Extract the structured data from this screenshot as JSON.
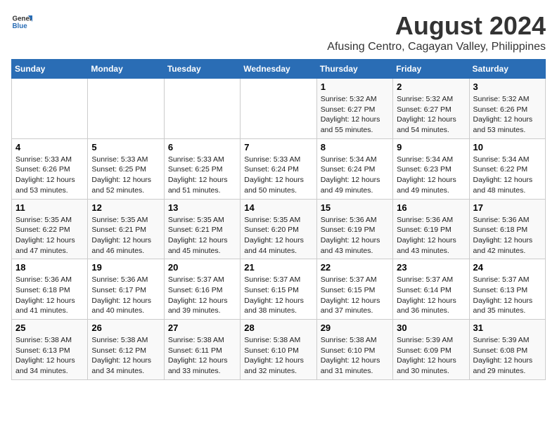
{
  "logo": {
    "general": "General",
    "blue": "Blue"
  },
  "title": "August 2024",
  "subtitle": "Afusing Centro, Cagayan Valley, Philippines",
  "days_of_week": [
    "Sunday",
    "Monday",
    "Tuesday",
    "Wednesday",
    "Thursday",
    "Friday",
    "Saturday"
  ],
  "weeks": [
    [
      {
        "day": "",
        "info": ""
      },
      {
        "day": "",
        "info": ""
      },
      {
        "day": "",
        "info": ""
      },
      {
        "day": "",
        "info": ""
      },
      {
        "day": "1",
        "info": "Sunrise: 5:32 AM\nSunset: 6:27 PM\nDaylight: 12 hours\nand 55 minutes."
      },
      {
        "day": "2",
        "info": "Sunrise: 5:32 AM\nSunset: 6:27 PM\nDaylight: 12 hours\nand 54 minutes."
      },
      {
        "day": "3",
        "info": "Sunrise: 5:32 AM\nSunset: 6:26 PM\nDaylight: 12 hours\nand 53 minutes."
      }
    ],
    [
      {
        "day": "4",
        "info": "Sunrise: 5:33 AM\nSunset: 6:26 PM\nDaylight: 12 hours\nand 53 minutes."
      },
      {
        "day": "5",
        "info": "Sunrise: 5:33 AM\nSunset: 6:25 PM\nDaylight: 12 hours\nand 52 minutes."
      },
      {
        "day": "6",
        "info": "Sunrise: 5:33 AM\nSunset: 6:25 PM\nDaylight: 12 hours\nand 51 minutes."
      },
      {
        "day": "7",
        "info": "Sunrise: 5:33 AM\nSunset: 6:24 PM\nDaylight: 12 hours\nand 50 minutes."
      },
      {
        "day": "8",
        "info": "Sunrise: 5:34 AM\nSunset: 6:24 PM\nDaylight: 12 hours\nand 49 minutes."
      },
      {
        "day": "9",
        "info": "Sunrise: 5:34 AM\nSunset: 6:23 PM\nDaylight: 12 hours\nand 49 minutes."
      },
      {
        "day": "10",
        "info": "Sunrise: 5:34 AM\nSunset: 6:22 PM\nDaylight: 12 hours\nand 48 minutes."
      }
    ],
    [
      {
        "day": "11",
        "info": "Sunrise: 5:35 AM\nSunset: 6:22 PM\nDaylight: 12 hours\nand 47 minutes."
      },
      {
        "day": "12",
        "info": "Sunrise: 5:35 AM\nSunset: 6:21 PM\nDaylight: 12 hours\nand 46 minutes."
      },
      {
        "day": "13",
        "info": "Sunrise: 5:35 AM\nSunset: 6:21 PM\nDaylight: 12 hours\nand 45 minutes."
      },
      {
        "day": "14",
        "info": "Sunrise: 5:35 AM\nSunset: 6:20 PM\nDaylight: 12 hours\nand 44 minutes."
      },
      {
        "day": "15",
        "info": "Sunrise: 5:36 AM\nSunset: 6:19 PM\nDaylight: 12 hours\nand 43 minutes."
      },
      {
        "day": "16",
        "info": "Sunrise: 5:36 AM\nSunset: 6:19 PM\nDaylight: 12 hours\nand 43 minutes."
      },
      {
        "day": "17",
        "info": "Sunrise: 5:36 AM\nSunset: 6:18 PM\nDaylight: 12 hours\nand 42 minutes."
      }
    ],
    [
      {
        "day": "18",
        "info": "Sunrise: 5:36 AM\nSunset: 6:18 PM\nDaylight: 12 hours\nand 41 minutes."
      },
      {
        "day": "19",
        "info": "Sunrise: 5:36 AM\nSunset: 6:17 PM\nDaylight: 12 hours\nand 40 minutes."
      },
      {
        "day": "20",
        "info": "Sunrise: 5:37 AM\nSunset: 6:16 PM\nDaylight: 12 hours\nand 39 minutes."
      },
      {
        "day": "21",
        "info": "Sunrise: 5:37 AM\nSunset: 6:15 PM\nDaylight: 12 hours\nand 38 minutes."
      },
      {
        "day": "22",
        "info": "Sunrise: 5:37 AM\nSunset: 6:15 PM\nDaylight: 12 hours\nand 37 minutes."
      },
      {
        "day": "23",
        "info": "Sunrise: 5:37 AM\nSunset: 6:14 PM\nDaylight: 12 hours\nand 36 minutes."
      },
      {
        "day": "24",
        "info": "Sunrise: 5:37 AM\nSunset: 6:13 PM\nDaylight: 12 hours\nand 35 minutes."
      }
    ],
    [
      {
        "day": "25",
        "info": "Sunrise: 5:38 AM\nSunset: 6:13 PM\nDaylight: 12 hours\nand 34 minutes."
      },
      {
        "day": "26",
        "info": "Sunrise: 5:38 AM\nSunset: 6:12 PM\nDaylight: 12 hours\nand 34 minutes."
      },
      {
        "day": "27",
        "info": "Sunrise: 5:38 AM\nSunset: 6:11 PM\nDaylight: 12 hours\nand 33 minutes."
      },
      {
        "day": "28",
        "info": "Sunrise: 5:38 AM\nSunset: 6:10 PM\nDaylight: 12 hours\nand 32 minutes."
      },
      {
        "day": "29",
        "info": "Sunrise: 5:38 AM\nSunset: 6:10 PM\nDaylight: 12 hours\nand 31 minutes."
      },
      {
        "day": "30",
        "info": "Sunrise: 5:39 AM\nSunset: 6:09 PM\nDaylight: 12 hours\nand 30 minutes."
      },
      {
        "day": "31",
        "info": "Sunrise: 5:39 AM\nSunset: 6:08 PM\nDaylight: 12 hours\nand 29 minutes."
      }
    ]
  ]
}
